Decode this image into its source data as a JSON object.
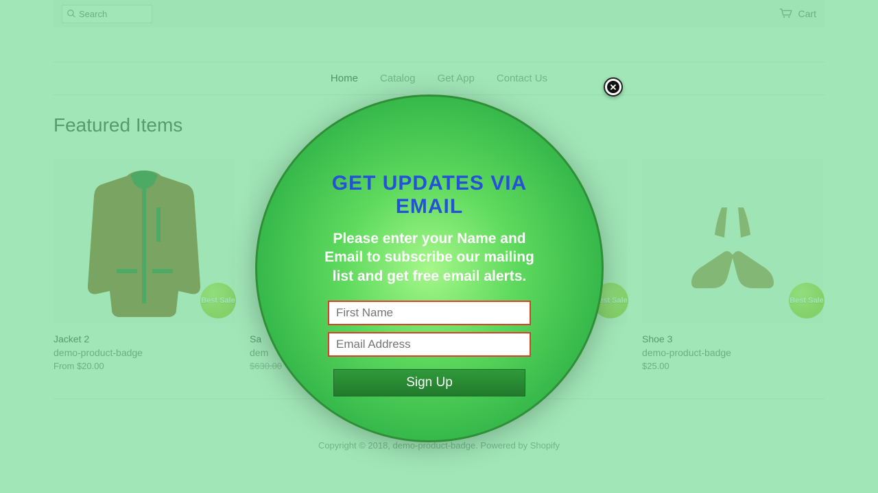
{
  "topbar": {
    "search_placeholder": "Search",
    "cart_label": "Cart"
  },
  "nav": {
    "items": [
      {
        "label": "Home",
        "active": true
      },
      {
        "label": "Catalog",
        "active": false
      },
      {
        "label": "Get App",
        "active": false
      },
      {
        "label": "Contact Us",
        "active": false
      }
    ]
  },
  "section": {
    "heading": "Featured Items"
  },
  "badge_text": "Best Sale",
  "products": [
    {
      "title": "Jacket 2",
      "vendor": "demo-product-badge",
      "price": "From $20.00",
      "compare": ""
    },
    {
      "title": "Sa",
      "vendor": "dem",
      "price": "$630.00",
      "compare": ""
    },
    {
      "title": "",
      "vendor": "",
      "price": "",
      "compare": ""
    },
    {
      "title": "Shoe 3",
      "vendor": "demo-product-badge",
      "price": "$25.00",
      "compare": ""
    }
  ],
  "footer": {
    "text": "Copyright © 2018, demo-product-badge. Powered by Shopify"
  },
  "modal": {
    "heading": "GET UPDATES VIA EMAIL",
    "subtext": "Please enter your Name and Email to subscribe our mailing list and get free email alerts.",
    "first_name_placeholder": "First Name",
    "email_placeholder": "Email Address",
    "signup_label": "Sign Up"
  },
  "colors": {
    "overlay": "rgba(99,214,135,0.6)",
    "modal_border": "#2f8f36",
    "heading": "#2451d8",
    "input_border": "#d9402c"
  }
}
